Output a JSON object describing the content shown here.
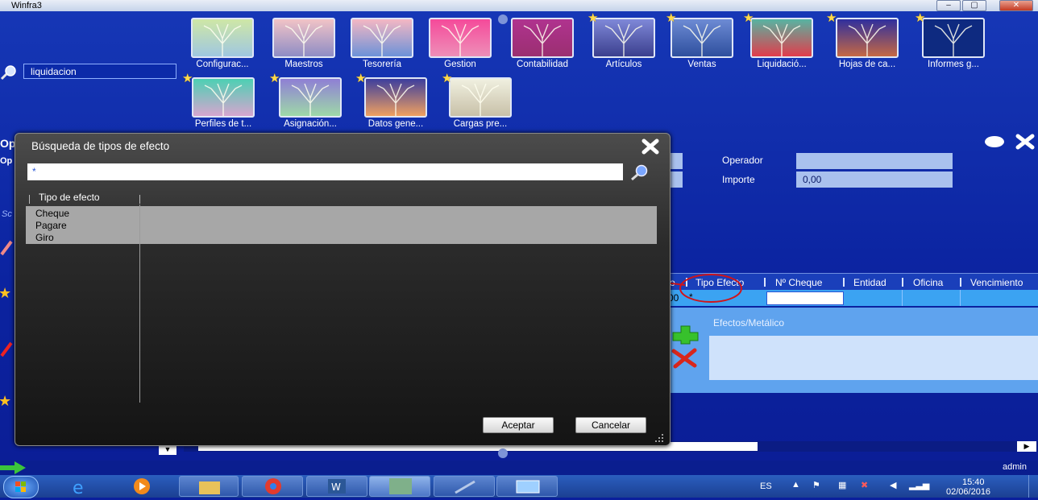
{
  "window": {
    "title": "Winfra3"
  },
  "tiles": [
    {
      "label": "Configurac...",
      "color_top": "#cfe7a6",
      "color_bottom": "#9fc7e0",
      "starred": false
    },
    {
      "label": "Maestros",
      "color_top": "#f1c3c6",
      "color_bottom": "#8e8dc5",
      "starred": false
    },
    {
      "label": "Tesorería",
      "color_top": "#f4b7c3",
      "color_bottom": "#6c92d8",
      "starred": false
    },
    {
      "label": "Gestion",
      "color_top": "#f54a9a",
      "color_bottom": "#ee8fb8",
      "starred": false
    },
    {
      "label": "Contabilidad",
      "color_top": "#b0338f",
      "color_bottom": "#9b2f71",
      "starred": false
    },
    {
      "label": "Artículos",
      "color_top": "#7f88d8",
      "color_bottom": "#3b3f8e",
      "starred": true
    },
    {
      "label": "Ventas",
      "color_top": "#6d8bd4",
      "color_bottom": "#2e4f9e",
      "starred": true
    },
    {
      "label": "Liquidació...",
      "color_top": "#57b4a2",
      "color_bottom": "#e23c4b",
      "starred": true
    },
    {
      "label": "Hojas de ca...",
      "color_top": "#2f2f9e",
      "color_bottom": "#c56844",
      "starred": true
    },
    {
      "label": "Informes g...",
      "color_top": "#0e2a80",
      "color_bottom": "#0e2a80",
      "starred": true
    },
    {
      "label": "Perfiles de t...",
      "color_top": "#4dd0b3",
      "color_bottom": "#d7a5cf",
      "starred": true
    },
    {
      "label": "Asignación...",
      "color_top": "#8f7fd5",
      "color_bottom": "#9ed9a8",
      "starred": true
    },
    {
      "label": "Datos gene...",
      "color_top": "#3c3e9e",
      "color_bottom": "#f0a060",
      "starred": true
    },
    {
      "label": "Cargas pre...",
      "color_top": "#f0f0e0",
      "color_bottom": "#c8c0a8",
      "starred": true
    }
  ],
  "search": {
    "value": "liquidacion"
  },
  "form": {
    "operador_label": "Operador",
    "operador_value": "",
    "importe_label": "Importe",
    "importe_value": "0,00"
  },
  "grid": {
    "columns": [
      "o",
      "Tipo Efecto",
      "Nº Cheque",
      "Entidad",
      "Oficina",
      "Vencimiento"
    ],
    "row": {
      "col0": "00",
      "tipo_efecto": "*"
    },
    "panel_title": "Efectos/Metálico"
  },
  "dialog": {
    "title": "Búsqueda de tipos de efecto",
    "search_value": "*",
    "column": "Tipo de efecto",
    "items": [
      "Cheque",
      "Pagare",
      "Giro"
    ],
    "accept_label": "Aceptar",
    "cancel_label": "Cancelar"
  },
  "status": {
    "user": "admin"
  },
  "taskbar": {
    "lang": "ES",
    "time": "15:40",
    "date": "02/06/2016"
  },
  "left_labels": {
    "op1": "Op",
    "op2": "Op",
    "sc": "Sc"
  }
}
